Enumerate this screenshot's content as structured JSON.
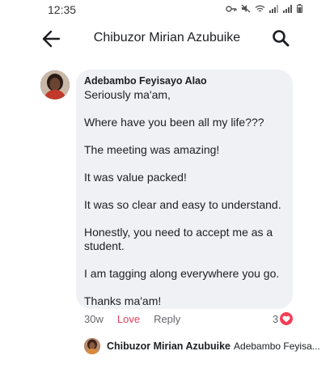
{
  "status": {
    "time": "12:35"
  },
  "header": {
    "title": "Chibuzor Mirian Azubuike",
    "back_icon": "arrow-left-icon",
    "search_icon": "search-icon"
  },
  "comment": {
    "author": "Adebambo Feyisayo Alao",
    "lines": [
      "Seriously ma'am,",
      "Where have you been all my life???",
      "The meeting was amazing!",
      "It was value packed!",
      "It was so clear and easy to understand.",
      "Honestly, you need to accept me as a",
      "student.",
      "I am tagging along everywhere you go.",
      "Thanks ma'am!"
    ],
    "time_ago": "30w",
    "love_label": "Love",
    "reply_label": "Reply",
    "reaction_count": "3",
    "reaction_color": "#f33e58"
  },
  "reply": {
    "author": "Chibuzor Mirian Azubuike",
    "preview": "Adebambo Feyisa..."
  }
}
